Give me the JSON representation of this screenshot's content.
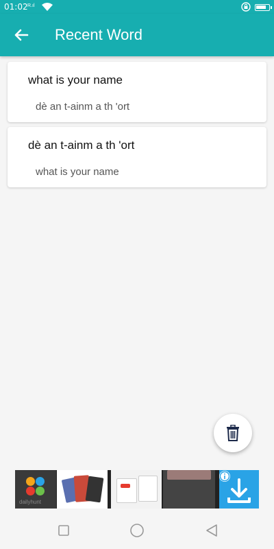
{
  "status_bar": {
    "time": "01:02",
    "signal_text": "R.ıl"
  },
  "app_bar": {
    "title": "Recent Word",
    "back_icon": "arrow-left-icon"
  },
  "recent_words": [
    {
      "word": "what is your name",
      "translation": "dè an t-ainm a th 'ort"
    },
    {
      "word": "dè an t-ainm a th 'ort",
      "translation": "what is your name"
    }
  ],
  "fab": {
    "icon": "trash-icon"
  },
  "ad": {
    "brand": "dailyhunt",
    "info_icon": "info-icon",
    "close_label": "✕"
  },
  "colors": {
    "primary": "#17aeb0",
    "background": "#f5f5f5",
    "fab_icon": "#1d2a4a"
  }
}
